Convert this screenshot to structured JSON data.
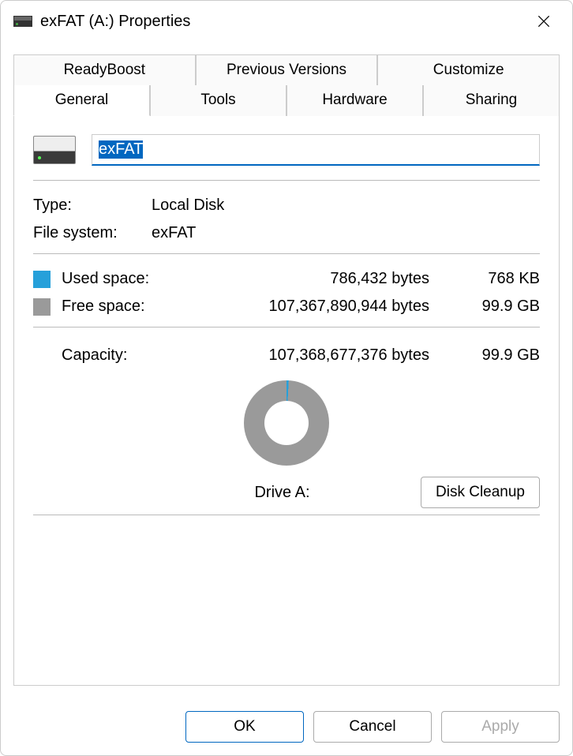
{
  "window": {
    "title": "exFAT (A:) Properties"
  },
  "tabs": {
    "row1": [
      "ReadyBoost",
      "Previous Versions",
      "Customize"
    ],
    "row2": [
      "General",
      "Tools",
      "Hardware",
      "Sharing"
    ],
    "active": "General"
  },
  "general": {
    "name_value": "exFAT",
    "type_label": "Type:",
    "type_value": "Local Disk",
    "fs_label": "File system:",
    "fs_value": "exFAT",
    "used_label": "Used space:",
    "used_bytes": "786,432 bytes",
    "used_hr": "768 KB",
    "free_label": "Free space:",
    "free_bytes": "107,367,890,944 bytes",
    "free_hr": "99.9 GB",
    "capacity_label": "Capacity:",
    "capacity_bytes": "107,368,677,376 bytes",
    "capacity_hr": "99.9 GB",
    "drive_label": "Drive A:",
    "cleanup_label": "Disk Cleanup"
  },
  "footer": {
    "ok": "OK",
    "cancel": "Cancel",
    "apply": "Apply"
  },
  "chart_data": {
    "type": "pie",
    "title": "Drive A:",
    "series": [
      {
        "name": "Used space",
        "value": 786432,
        "color": "#26a0da"
      },
      {
        "name": "Free space",
        "value": 107367890944,
        "color": "#9a9a9a"
      }
    ]
  }
}
